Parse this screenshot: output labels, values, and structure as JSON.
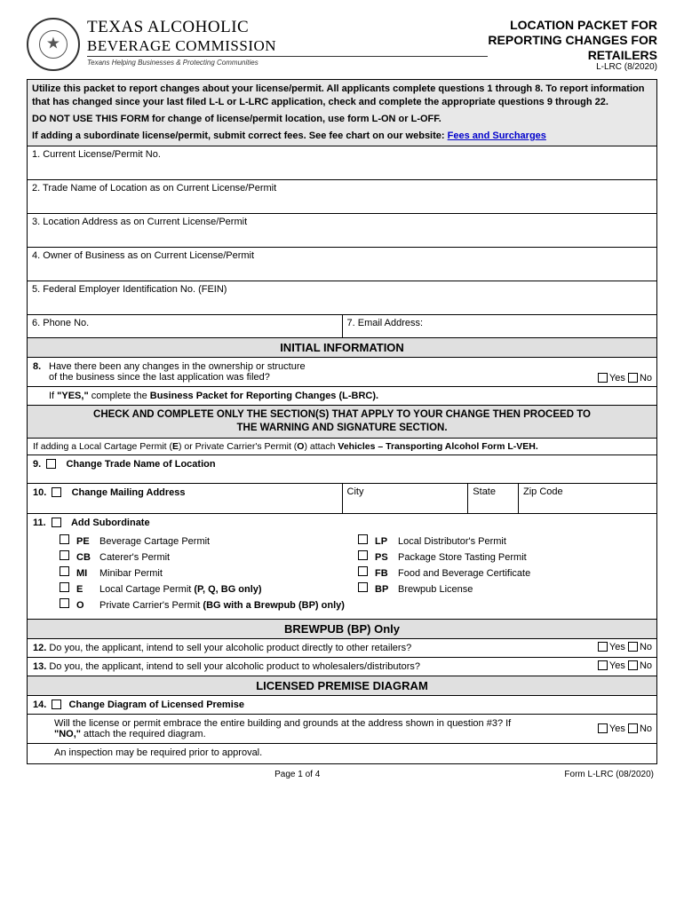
{
  "header": {
    "org_name_1": "TEXAS ALCOHOLIC",
    "org_name_2": "BEVERAGE COMMISSION",
    "tagline": "Texans Helping Businesses & Protecting Communities",
    "title_1": "LOCATION PACKET FOR",
    "title_2": "REPORTING CHANGES FOR",
    "title_3": "RETAILERS",
    "form_code": "L-LRC (8/2020)"
  },
  "instructions": {
    "p1": "Utilize this packet to report changes about your license/permit.  All applicants complete questions 1 through 8.  To report information that has changed since your last filed L-L or L-LRC application, check and complete the appropriate questions 9 through 22.",
    "p2": "DO NOT USE THIS FORM for change of license/permit location, use form L-ON or L-OFF.",
    "p3_pre": "If adding a subordinate license/permit, submit correct fees.  See fee chart on our website: ",
    "p3_link": "Fees and Surcharges"
  },
  "fields": {
    "q1": "1.  Current License/Permit No.",
    "q2": "2.  Trade Name of Location as on Current License/Permit",
    "q3": "3.  Location Address as on Current License/Permit",
    "q4": "4.  Owner of Business as on Current License/Permit",
    "q5": "5.  Federal Employer Identification No. (FEIN)",
    "q6": "6.  Phone No.",
    "q7": "7.   Email Address:"
  },
  "sections": {
    "initial": "INITIAL INFORMATION",
    "brewpub": "BREWPUB (BP) Only",
    "premise": "LICENSED PREMISE DIAGRAM"
  },
  "q8": {
    "num": "8.",
    "line1": "Have there been any changes in the ownership or structure",
    "line2": "of the business since the last application was filed?",
    "ifyes_pre": "If ",
    "ifyes_yes": "\"YES,\"",
    "ifyes_mid": " complete the ",
    "ifyes_bold": "Business Packet for Reporting Changes (L-BRC)."
  },
  "check_head": {
    "l1": "CHECK AND COMPLETE ONLY THE SECTION(S) THAT APPLY TO YOUR CHANGE THEN PROCEED TO",
    "l2": "THE WARNING AND SIGNATURE SECTION."
  },
  "veh_note": {
    "pre": "If adding a Local Cartage Permit (",
    "e": "E",
    "mid1": ") or Private Carrier's Permit (",
    "o": "O",
    "mid2": ") attach ",
    "bold": "Vehicles – Transporting Alcohol Form L-VEH."
  },
  "q9": {
    "num": "9.",
    "label": "Change Trade Name of Location"
  },
  "q10": {
    "num": "10.",
    "label": "Change Mailing Address",
    "city": "City",
    "state": "State",
    "zip": "Zip Code"
  },
  "q11": {
    "num": "11.",
    "label": "Add Subordinate",
    "left": [
      {
        "code": "PE",
        "desc": "Beverage Cartage Permit"
      },
      {
        "code": "CB",
        "desc": "Caterer's Permit"
      },
      {
        "code": "MI",
        "desc": "Minibar Permit"
      },
      {
        "code": "E",
        "desc": "Local Cartage Permit ",
        "bold": "(P, Q, BG only)"
      },
      {
        "code": "O",
        "desc": "Private Carrier's Permit ",
        "bold": "(BG with a Brewpub (BP) only)"
      }
    ],
    "right": [
      {
        "code": "LP",
        "desc": "Local Distributor's Permit"
      },
      {
        "code": "PS",
        "desc": "Package Store Tasting Permit"
      },
      {
        "code": "FB",
        "desc": "Food and Beverage Certificate"
      },
      {
        "code": "BP",
        "desc": "Brewpub License"
      }
    ]
  },
  "q12": {
    "num": "12.",
    "text": "Do you, the applicant, intend to sell your alcoholic product directly to other retailers?"
  },
  "q13": {
    "num": "13.",
    "text": "Do you, the applicant, intend to sell your alcoholic product to wholesalers/distributors?"
  },
  "q14": {
    "num": "14.",
    "label": "Change Diagram of Licensed Premise",
    "sub1": "Will the license or permit embrace the entire building and grounds at the address shown in question #3?  If ",
    "sub_no": "\"NO,\"",
    "sub1b": " attach the required diagram.",
    "sub2": "An inspection may be required prior to approval."
  },
  "yn": {
    "yes": "Yes",
    "no": "No"
  },
  "footer": {
    "page": "Page 1 of 4",
    "form": "Form L-LRC (08/2020)"
  }
}
